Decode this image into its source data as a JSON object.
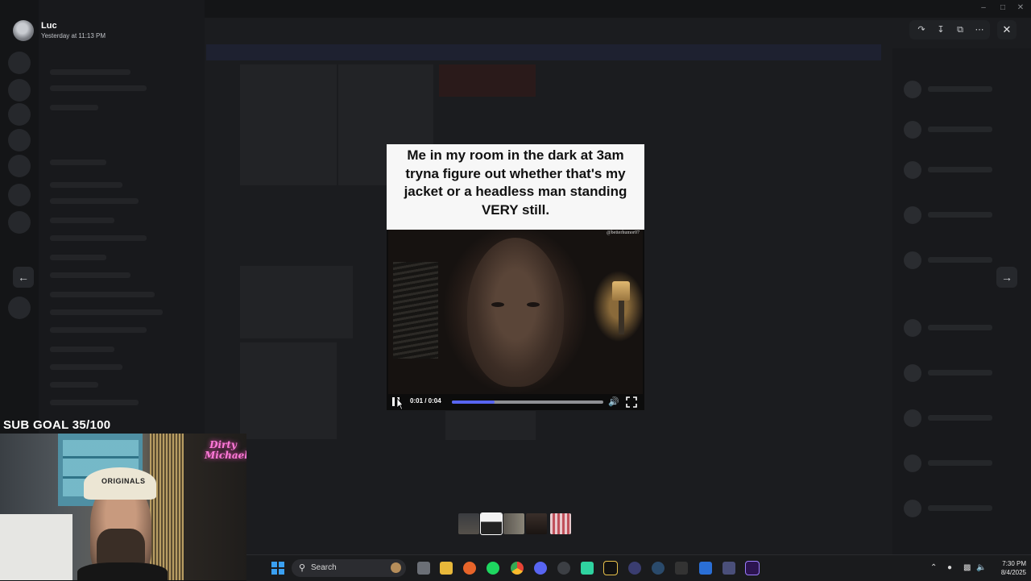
{
  "viewer": {
    "author_name": "Luc",
    "timestamp": "Yesterday at 11:13 PM",
    "caption": "Me in my room in the dark at 3am tryna figure out whether that's my jacket or a headless man standing VERY still.",
    "watermark": "@betterhumor07",
    "time_display": "0:01 / 0:04",
    "progress": 0.28,
    "toolbar_icons": [
      "forward-icon",
      "download-icon",
      "open-in-browser-icon",
      "more-icon"
    ],
    "close_icon": "close-icon",
    "prev_icon": "arrow-left-icon",
    "next_icon": "arrow-right-icon",
    "accent_color": "#5865f2"
  },
  "stream": {
    "sub_goal": "SUB GOAL 35/100",
    "neon_sign": "Dirty Michael",
    "cap_text": "ORIGINALS"
  },
  "taskbar": {
    "search_label": "Search",
    "time": "7:30 PM",
    "date": "8/4/2025"
  }
}
